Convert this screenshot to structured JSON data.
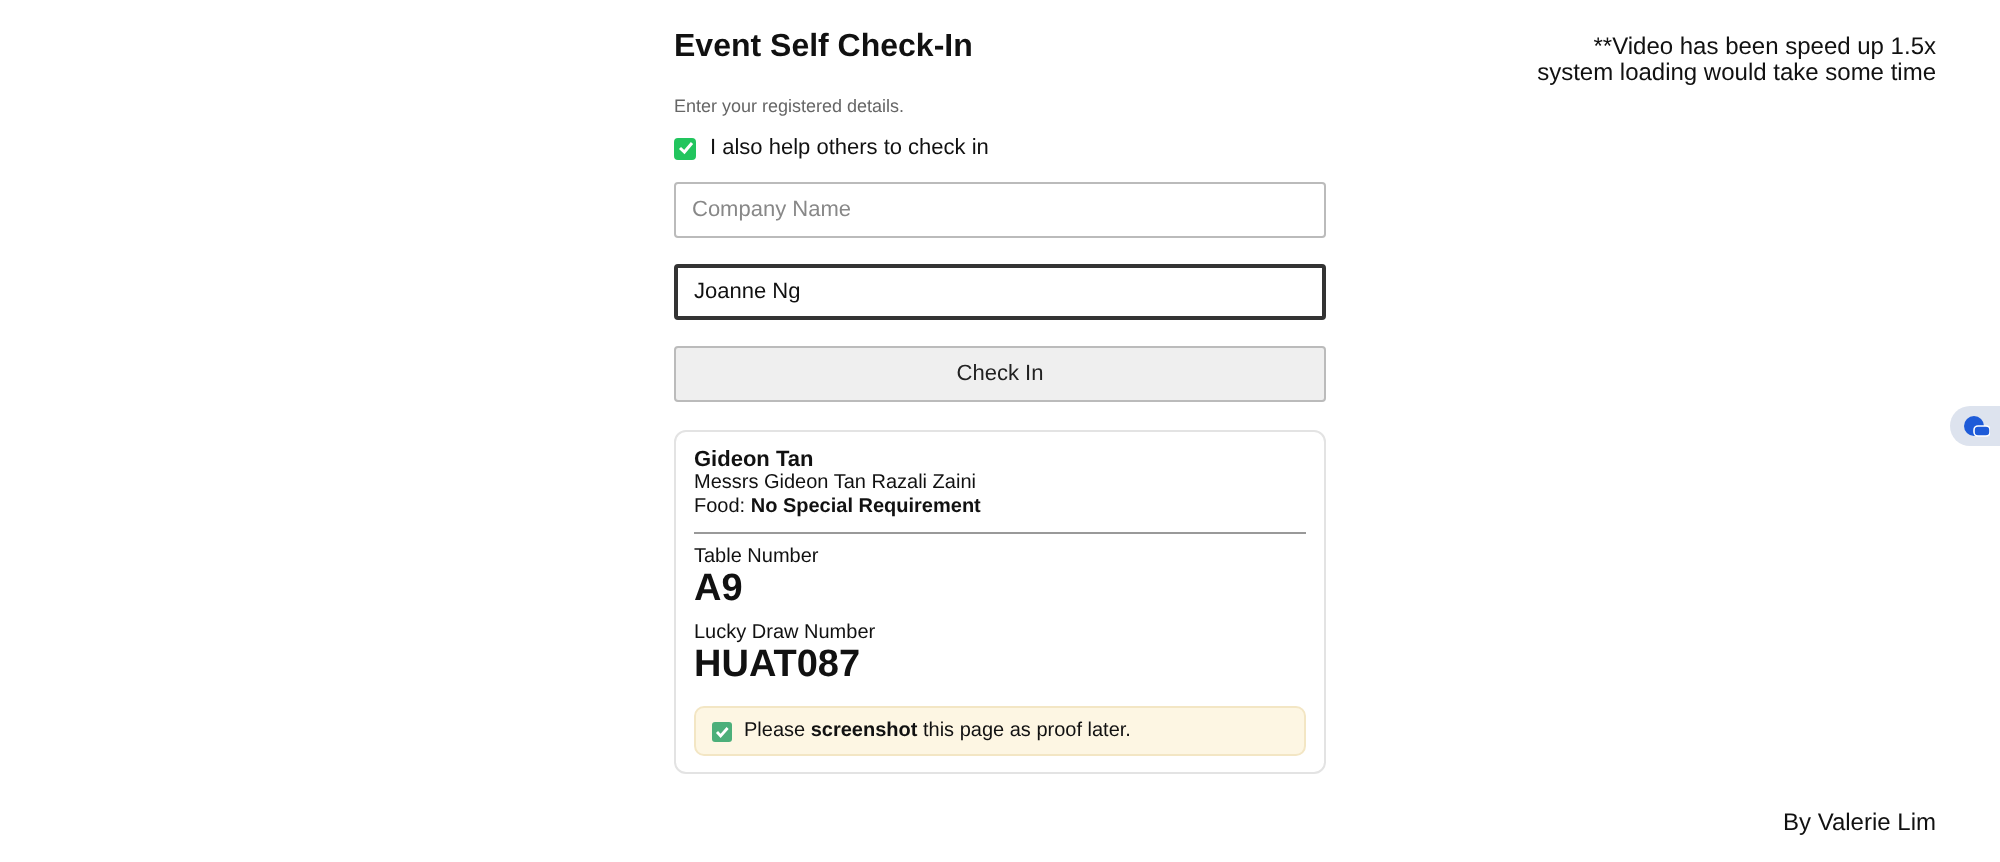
{
  "title": "Event Self Check-In",
  "subtitle": "Enter your registered details.",
  "help_others": {
    "label": "I also help others to check in",
    "checked": true
  },
  "fields": [
    {
      "placeholder": "Company Name",
      "focused": false
    },
    {
      "value": "Joanne Ng",
      "focused": true
    }
  ],
  "button": "Check In",
  "result": {
    "name": "Gideon Tan",
    "salutation": "Messrs Gideon Tan Razali Zaini",
    "food": "Food: **No Special Requirement**",
    "table_label": "Table Number",
    "table": "A9",
    "lucky_label": "Lucky Draw Number",
    "lucky": "HUAT087",
    "notice": "Please **screenshot** this page as proof later."
  },
  "note": [
    "**Video has been speed up 1.5x",
    "system loading would take some time"
  ],
  "credit": "By Valerie Lim"
}
